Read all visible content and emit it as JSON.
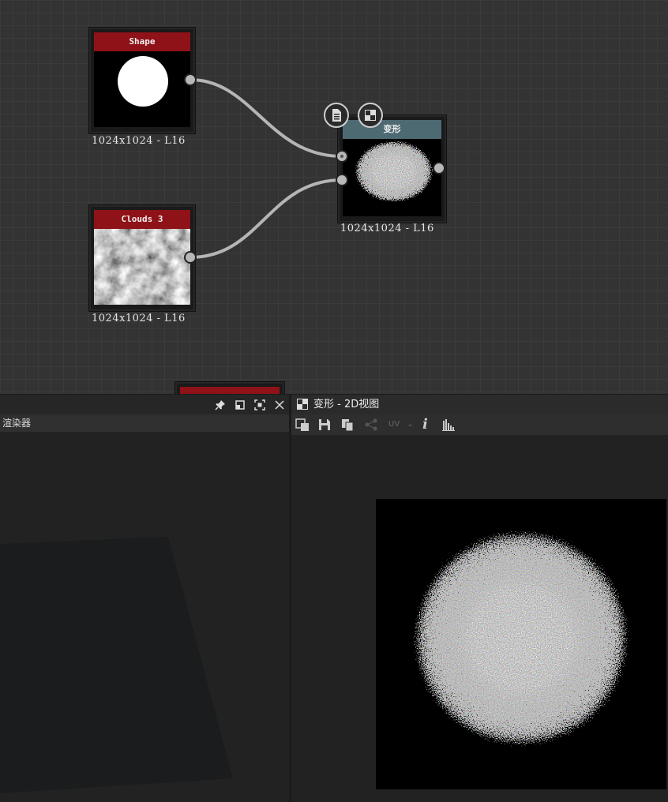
{
  "graph": {
    "nodes": [
      {
        "id": "shape",
        "title": "Shape",
        "label": "1024x1024 - L16",
        "header_color": "#8f1218"
      },
      {
        "id": "clouds3",
        "title": "Clouds 3",
        "label": "1024x1024 - L16",
        "header_color": "#8f1218"
      },
      {
        "id": "transform",
        "title": "变形",
        "label": "1024x1024 - L16",
        "header_color": "#4d6a73"
      }
    ],
    "context_buttons": [
      "document-list-icon",
      "checker-icon"
    ]
  },
  "renderer_panel": {
    "tab_label": "渲染器",
    "header_icons": [
      "pin-icon",
      "float-icon",
      "maximize-icon",
      "close-icon"
    ]
  },
  "view2d_panel": {
    "title": "变形 - 2D视图",
    "toolbar": {
      "uv_label": "UV",
      "info_label": "i",
      "icons": [
        "channels-icon",
        "save-icon",
        "copy-icon",
        "share-icon",
        "uv-dropdown",
        "info-icon",
        "histogram-icon"
      ]
    }
  },
  "colors": {
    "graph_bg": "#333333",
    "node_red": "#8f1218",
    "node_teal": "#4d6a73",
    "wire": "#b5b5b5"
  }
}
